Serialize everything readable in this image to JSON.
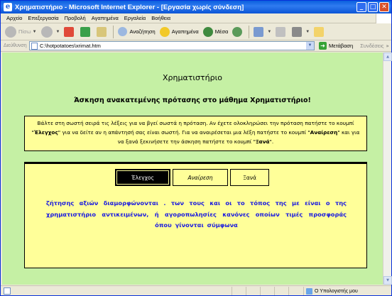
{
  "window": {
    "title": "Χρηματιστήριο - Microsoft Internet Explorer - [Εργασία χωρίς σύνδεση]",
    "controls": {
      "minimize": "_",
      "maximize": "□",
      "close": "✕"
    }
  },
  "menu": [
    "Αρχείο",
    "Επεξεργασία",
    "Προβολή",
    "Αγαπημένα",
    "Εργαλεία",
    "Βοήθεια"
  ],
  "toolbar": {
    "back_label": "Πίσω",
    "search_label": "Αναζήτηση",
    "favorites_label": "Αγαπημένα",
    "media_label": "Μέσα"
  },
  "address": {
    "label": "Διεύθυνση",
    "url": "C:\\hotpotatoes\\xrimat.htm",
    "go_label": "Μετάβαση",
    "links_label": "Συνδέσεις"
  },
  "page": {
    "title": "Χρηματιστήριο",
    "subtitle": "Άσκηση ανακατεμένης πρότασης στο μάθημα Χρηματιστήριο!",
    "instructions": {
      "part1": "Βάλτε στη σωστή σειρά τις λέξεις για να βγεί σωστά η πρόταση. Αν έχετε ολοκληρώσει την πρόταση πατήστε το κουμπί \"",
      "check_word": "Έλεγχος",
      "part2": "\" για να δείτε αν η απάντησή σας είναι σωστή. Για να αναιρέσεται μια λέξη πατήστε το κουμπί \"",
      "undo_word": "Αναίρεση",
      "part3": "\" και για να ξανά ξεκινήσετε την άσκηση πατήστε το κουμπί \"",
      "again_word": "Ξανά",
      "part4": "\"."
    },
    "buttons": {
      "check": "Έλεγχος",
      "undo": "Αναίρεση",
      "again": "Ξανά"
    },
    "words": [
      "ζήτησης",
      "αξιών",
      "διαμορφώνονται",
      ".",
      "των",
      "τους",
      "και",
      "οι",
      "το",
      "τόπος",
      "της",
      "με",
      "είναι",
      "ο",
      "της",
      "χρηματιστήριο",
      "αντικειμένων,",
      "ή",
      "αγοροπωλησίες",
      "κανόνες",
      "οποίων",
      "τιμές",
      "προσφοράς",
      "όπου",
      "γίνονται",
      "σύμφωνα"
    ]
  },
  "status": {
    "zone": "Ο Υπολογιστής μου"
  }
}
